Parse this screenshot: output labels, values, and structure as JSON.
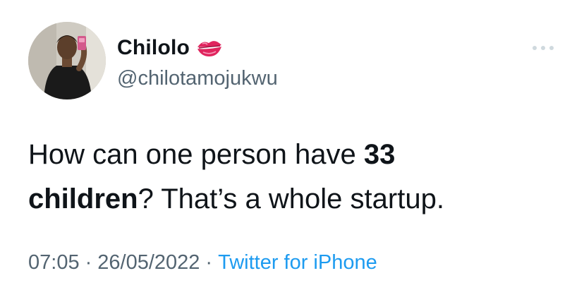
{
  "author": {
    "display_name": "Chilolo",
    "name_emoji_icon": "kiss-mark-icon",
    "handle": "@chilotamojukwu"
  },
  "tweet": {
    "text_part1": "How can one person have ",
    "text_bold1": "33",
    "text_part2": " ",
    "text_bold2": "children",
    "text_part3": "? That’s a whole startup."
  },
  "meta": {
    "time": "07:05",
    "separator": "·",
    "date": "26/05/2022",
    "source": "Twitter for iPhone"
  },
  "colors": {
    "text": "#0f1419",
    "secondary": "#536471",
    "link": "#1d9bf0",
    "kiss": "#e0245e"
  }
}
